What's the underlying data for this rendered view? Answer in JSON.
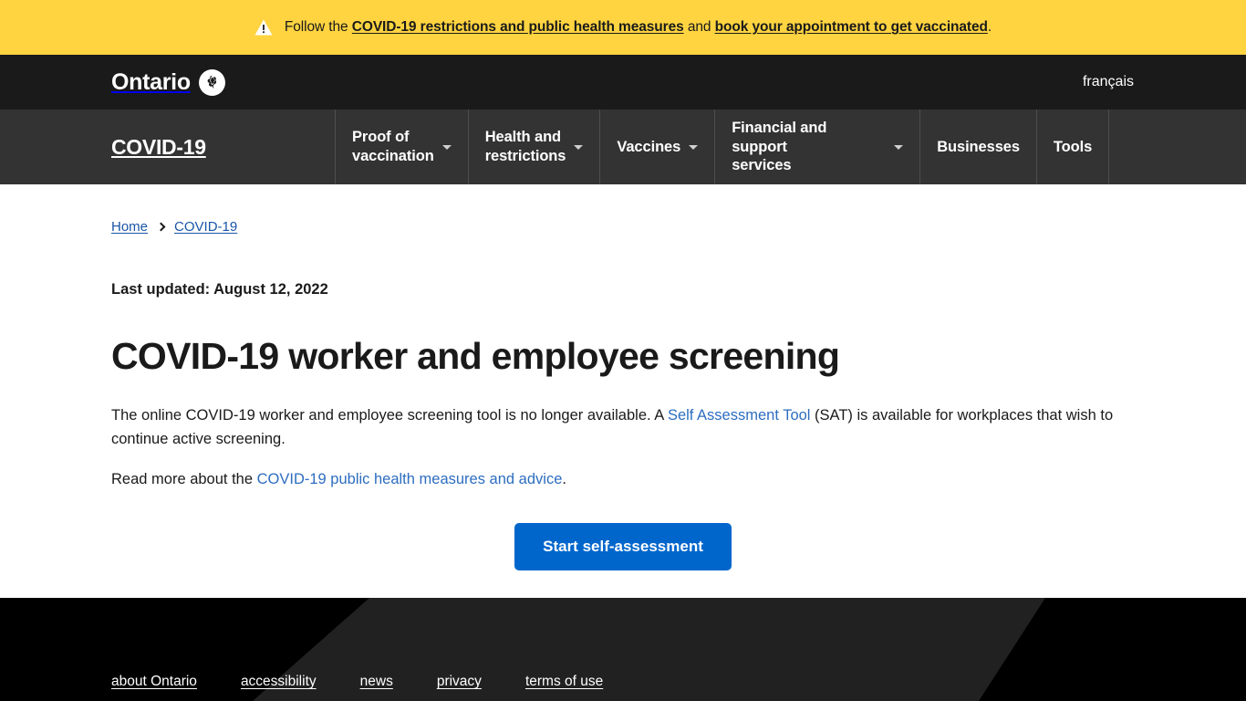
{
  "alert": {
    "icon": "warning-triangle-icon",
    "prefix": "Follow the ",
    "link1": "COVID-19 restrictions and public health measures",
    "middle": " and ",
    "link2": "book your appointment to get vaccinated",
    "suffix": ".",
    "background_color": "#ffd440"
  },
  "header": {
    "wordmark": "Ontario",
    "logo_icon": "ontario-trillium-icon",
    "language_link": "français",
    "background_color": "#1a1a1a"
  },
  "nav": {
    "brand": "COVID-19",
    "background_color": "#333333",
    "items": [
      {
        "label": "Proof of\nvaccination",
        "has_dropdown": true
      },
      {
        "label": "Health and\nrestrictions",
        "has_dropdown": true
      },
      {
        "label": "Vaccines",
        "has_dropdown": true
      },
      {
        "label": "Financial and support\nservices",
        "has_dropdown": true
      },
      {
        "label": "Businesses",
        "has_dropdown": false
      },
      {
        "label": "Tools",
        "has_dropdown": false
      }
    ]
  },
  "breadcrumb": {
    "home": "Home",
    "separator_icon": "chevron-right-icon",
    "current": "COVID-19"
  },
  "main": {
    "last_updated": "Last updated: August 12, 2022",
    "title": "COVID-19 worker and employee screening",
    "para1_a": "The online COVID-19 worker and employee screening tool is no longer available. A ",
    "para1_link": "Self Assessment Tool",
    "para1_b": " (SAT) is available for workplaces that wish to continue active screening.",
    "para2_a": "Read more about the ",
    "para2_link": "COVID-19 public health measures and advice",
    "para2_b": ".",
    "cta_label": "Start self-assessment",
    "cta_color": "#0066cc",
    "link_color": "#2d6dc0"
  },
  "footer": {
    "background_color": "#000000",
    "links": [
      "about Ontario",
      "accessibility",
      "news",
      "privacy",
      "terms of use"
    ]
  }
}
